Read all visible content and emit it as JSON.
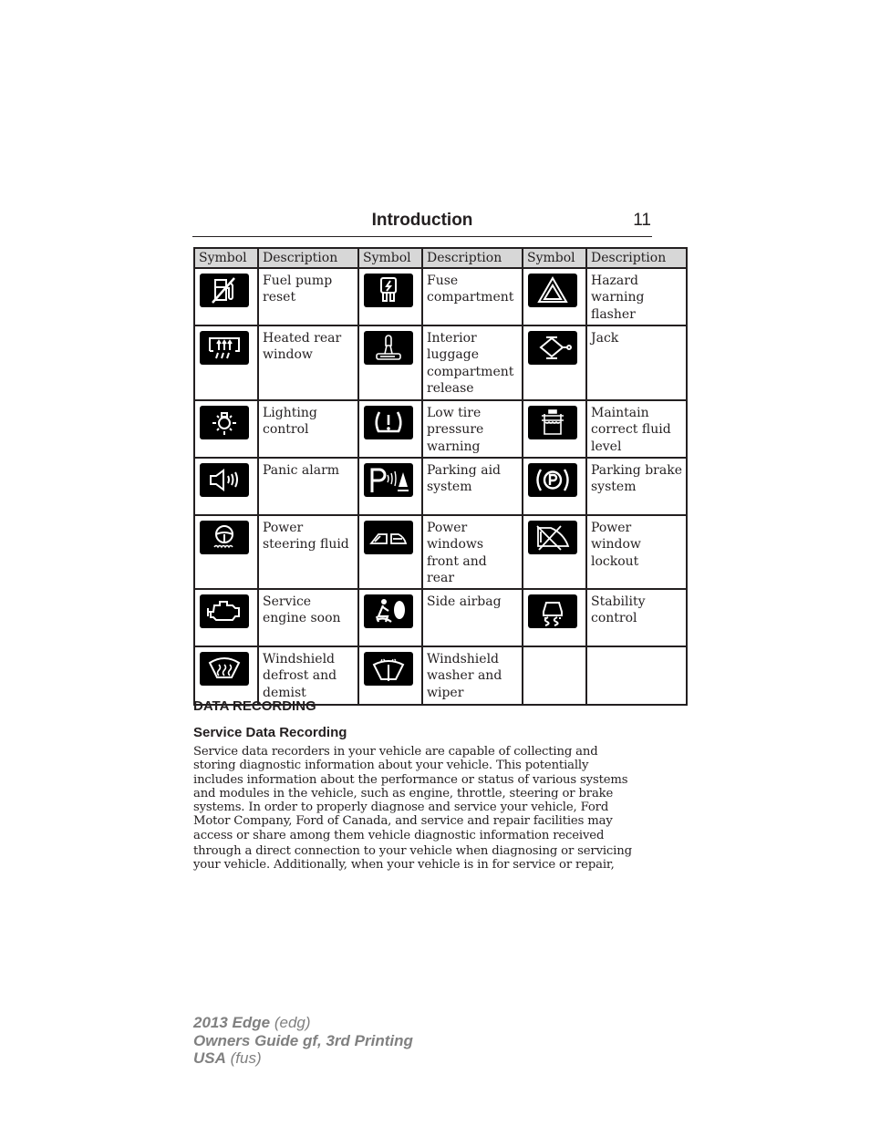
{
  "header": {
    "title": "Introduction",
    "page_number": "11"
  },
  "table": {
    "columns": [
      "Symbol",
      "Description",
      "Symbol",
      "Description",
      "Symbol",
      "Description"
    ],
    "rows": [
      [
        {
          "icon": "fuel-pump-reset-icon",
          "description": "Fuel pump reset"
        },
        {
          "icon": "fuse-compartment-icon",
          "description": "Fuse compartment"
        },
        {
          "icon": "hazard-warning-icon",
          "description": "Hazard warning flasher"
        }
      ],
      [
        {
          "icon": "heated-rear-window-icon",
          "description": "Heated rear window"
        },
        {
          "icon": "interior-luggage-release-icon",
          "description": "Interior luggage compartment release"
        },
        {
          "icon": "jack-icon",
          "description": "Jack"
        }
      ],
      [
        {
          "icon": "lighting-control-icon",
          "description": "Lighting control"
        },
        {
          "icon": "low-tire-pressure-icon",
          "description": "Low tire pressure warning"
        },
        {
          "icon": "fluid-level-icon",
          "description": "Maintain correct fluid level"
        }
      ],
      [
        {
          "icon": "panic-alarm-icon",
          "description": "Panic alarm"
        },
        {
          "icon": "parking-aid-icon",
          "description": "Parking aid system"
        },
        {
          "icon": "parking-brake-icon",
          "description": "Parking brake system"
        }
      ],
      [
        {
          "icon": "power-steering-fluid-icon",
          "description": "Power steering fluid"
        },
        {
          "icon": "power-windows-icon",
          "description": "Power windows front and rear"
        },
        {
          "icon": "power-window-lockout-icon",
          "description": "Power window lockout"
        }
      ],
      [
        {
          "icon": "service-engine-icon",
          "description": "Service engine soon"
        },
        {
          "icon": "side-airbag-icon",
          "description": "Side airbag"
        },
        {
          "icon": "stability-control-icon",
          "description": "Stability control"
        }
      ],
      [
        {
          "icon": "windshield-defrost-icon",
          "description": "Windshield defrost and demist"
        },
        {
          "icon": "windshield-washer-icon",
          "description": "Windshield washer and wiper"
        },
        {
          "icon": "",
          "description": ""
        }
      ]
    ]
  },
  "section": {
    "heading": "DATA RECORDING",
    "subheading": "Service Data Recording",
    "paragraph_lines": [
      "Service data recorders in your vehicle are capable of collecting and",
      "storing diagnostic information about your vehicle. This potentially",
      "includes information about the performance or status of various systems",
      "and modules in the vehicle, such as engine, throttle, steering or brake",
      "systems. In order to properly diagnose and service your vehicle, Ford",
      "Motor Company, Ford of Canada, and service and repair facilities may",
      "access or share among them vehicle diagnostic information received",
      "through a direct connection to your vehicle when diagnosing or servicing",
      "your vehicle. Additionally, when your vehicle is in for service or repair,"
    ]
  },
  "footer": {
    "line1_bold": "2013 Edge",
    "line1_rest": " (edg)",
    "line2_bold": "Owners Guide gf, 3rd Printing",
    "line3_bold": "USA",
    "line3_rest": " (fus)"
  }
}
